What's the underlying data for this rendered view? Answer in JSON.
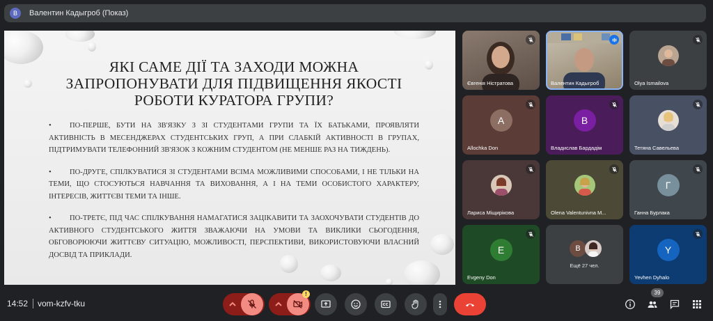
{
  "header": {
    "avatar_letter": "В",
    "presenter": "Валентин Кадыгроб (Показ)"
  },
  "slide": {
    "title": "ЯКІ САМЕ ДІЇ ТА ЗАХОДИ МОЖНА ЗАПРОПОНУВАТИ ДЛЯ ПІДВИЩЕННЯ ЯКОСТІ РОБОТИ КУРАТОРА ГРУПИ?",
    "bullet_char": "•",
    "paragraphs": [
      "ПО-ПЕРШЕ, БУТИ НА ЗВ'ЯЗКУ З ЗІ СТУДЕНТАМИ ГРУПИ ТА ЇХ БАТЬКАМИ, ПРОЯВЛЯТИ АКТИВНІСТЬ В МЕСЕНДЖЕРАХ СТУДЕНТСЬКИХ ГРУП, А ПРИ СЛАБКІЙ АКТИВНОСТІ В ГРУПАХ, ПІДТРИМУВАТИ ТЕЛЕФОННИЙ ЗВ'ЯЗОК З КОЖНИМ СТУДЕНТОМ (НЕ МЕНШЕ РАЗ НА ТИЖДЕНЬ).",
      "ПО-ДРУГЕ, СПІЛКУВАТИСЯ ЗІ СТУДЕНТАМИ ВСІМА МОЖЛИВИМИ СПОСОБАМИ, І НЕ ТІЛЬКИ НА ТЕМИ, ЩО СТОСУЮТЬСЯ НАВЧАННЯ ТА ВИХОВАННЯ, А І НА ТЕМИ ОСОБИСТОГО ХАРАКТЕРУ, ІНТЕРЕСІВ, ЖИТТЄВІ ТЕМИ ТА ІНШЕ.",
      "ПО-ТРЕТЄ, ПІД ЧАС СПІЛКУВАННЯ НАМАГАТИСЯ ЗАЦІКАВИТИ ТА ЗАОХОЧУВАТИ СТУДЕНТІВ ДО АКТИВНОГО СТУДЕНТСЬКОГО ЖИТТЯ ЗВАЖАЮЧИ НА УМОВИ ТА ВИКЛИКИ СЬОГОДЕННЯ, ОБГОВОРЮЮЧИ ЖИТТЄВУ СИТУАЦІЮ, МОЖЛИВОСТІ, ПЕРСПЕКТИВИ, ВИКОРИСТОВУЮЧИ ВЛАСНИЙ ДОСВІД ТА ПРИКЛАДИ."
    ]
  },
  "participants": [
    {
      "name": "Євгенія Ністратова",
      "muted": true
    },
    {
      "name": "Валентин Кадыгроб",
      "speaking": true
    },
    {
      "name": "Olya Ismailova",
      "muted": true
    },
    {
      "name": "Allochka Don",
      "letter": "A",
      "color": "#8d6e63",
      "muted": true
    },
    {
      "name": "Владислав Бардадім",
      "letter": "B",
      "color": "#7b1fa2",
      "muted": true
    },
    {
      "name": "Тетяна Савельева",
      "muted": true
    },
    {
      "name": "Лариса Міщирікова",
      "muted": true
    },
    {
      "name": "Olena Valentunivna M...",
      "muted": true
    },
    {
      "name": "Ганна Бурлака",
      "letter": "Г",
      "color": "#78909c",
      "muted": true
    },
    {
      "name": "Evgeny Don",
      "letter": "E",
      "color": "#2e7d32",
      "muted": true
    },
    {
      "name": "Ещё 27 чел.",
      "letter": "B"
    },
    {
      "name": "Yevhen Dyhalo",
      "letter": "Y",
      "color": "#1565c0",
      "muted": true
    }
  ],
  "bottom": {
    "time": "14:52",
    "meeting_code": "vom-kzfv-tku",
    "participants_count": "39",
    "camera_warning": "!"
  },
  "colors": {
    "end_call": "#ea4335",
    "muted_control": "#f28b82",
    "muted_bg": "#8c1d18"
  }
}
